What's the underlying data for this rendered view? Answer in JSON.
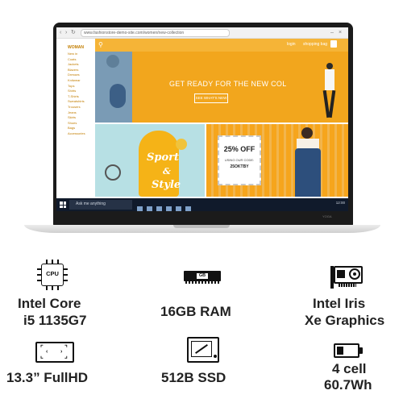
{
  "laptop": {
    "browser": {
      "url": "www.fashionstore-demo-site.com/women/new-collection"
    },
    "site": {
      "nav_title": "WOMAN",
      "nav_items": [
        "New in",
        "Coats",
        "Jackets",
        "Blazers",
        "Dresses",
        "Knitwear",
        "Tops",
        "Shirts",
        "T-Shirts",
        "Sweatshirts",
        "Trousers",
        "Jeans",
        "Skirts",
        "Shoes",
        "Bags",
        "Accessories"
      ],
      "hero_login": "login",
      "hero_bag": "shopping bag",
      "hero_headline": "GET READY FOR THE NEW COL",
      "hero_cta": "SEE WHAT'S NEW",
      "banner_left_line1": "Sport",
      "banner_left_line2": "&",
      "banner_left_line3": "Style",
      "banner_right_discount": "25% OFF",
      "banner_right_code_label": "USING OUR CODE:",
      "banner_right_code": "25OKTBY"
    },
    "taskbar": {
      "search_placeholder": "Ask me anything",
      "tray_text": "12:00"
    },
    "brand_tag": "YOGA"
  },
  "specs": {
    "cpu": {
      "icon_label": "CPU",
      "line1": "Intel Core",
      "line2": "i5 1135G7"
    },
    "ram": {
      "icon_label": "GB",
      "line1": "16GB RAM"
    },
    "gpu": {
      "line1": "Intel Iris",
      "line2": "Xe Graphics"
    },
    "screen": {
      "line1": "13.3” FullHD"
    },
    "storage": {
      "line1": "512B SSD"
    },
    "battery": {
      "line1": "4 cell",
      "line2": "60.7Wh",
      "charge_level": 0.35
    }
  }
}
